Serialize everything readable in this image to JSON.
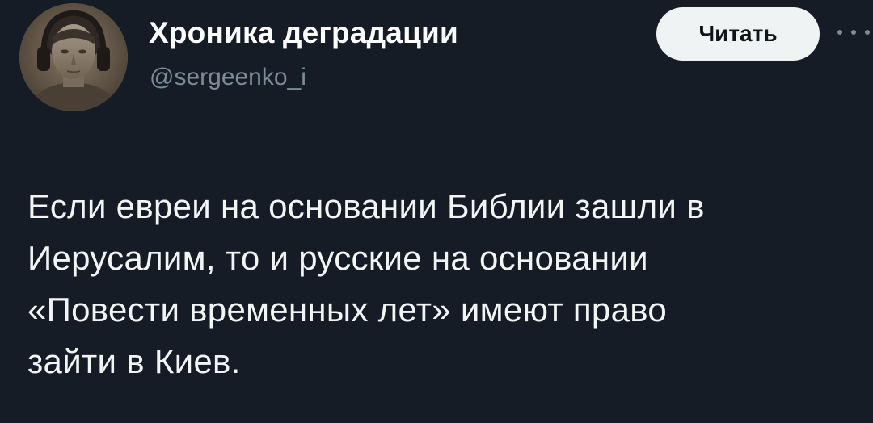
{
  "author": {
    "display_name": "Хроника деградации",
    "handle": "@sergeenko_i"
  },
  "actions": {
    "follow_label": "Читать",
    "more_icon": "more-horizontal-icon"
  },
  "tweet": {
    "lines": [
      "Если евреи на основании Библии зашли в",
      "Иерусалим, то и русские на основании",
      "«Повести временных лет» имеют право",
      "зайти в Киев."
    ]
  },
  "colors": {
    "background": "#151c26",
    "text": "#f2f4f5",
    "secondary_text": "#7d8b99",
    "button_bg": "#eff3f4",
    "button_text": "#0f1419"
  }
}
